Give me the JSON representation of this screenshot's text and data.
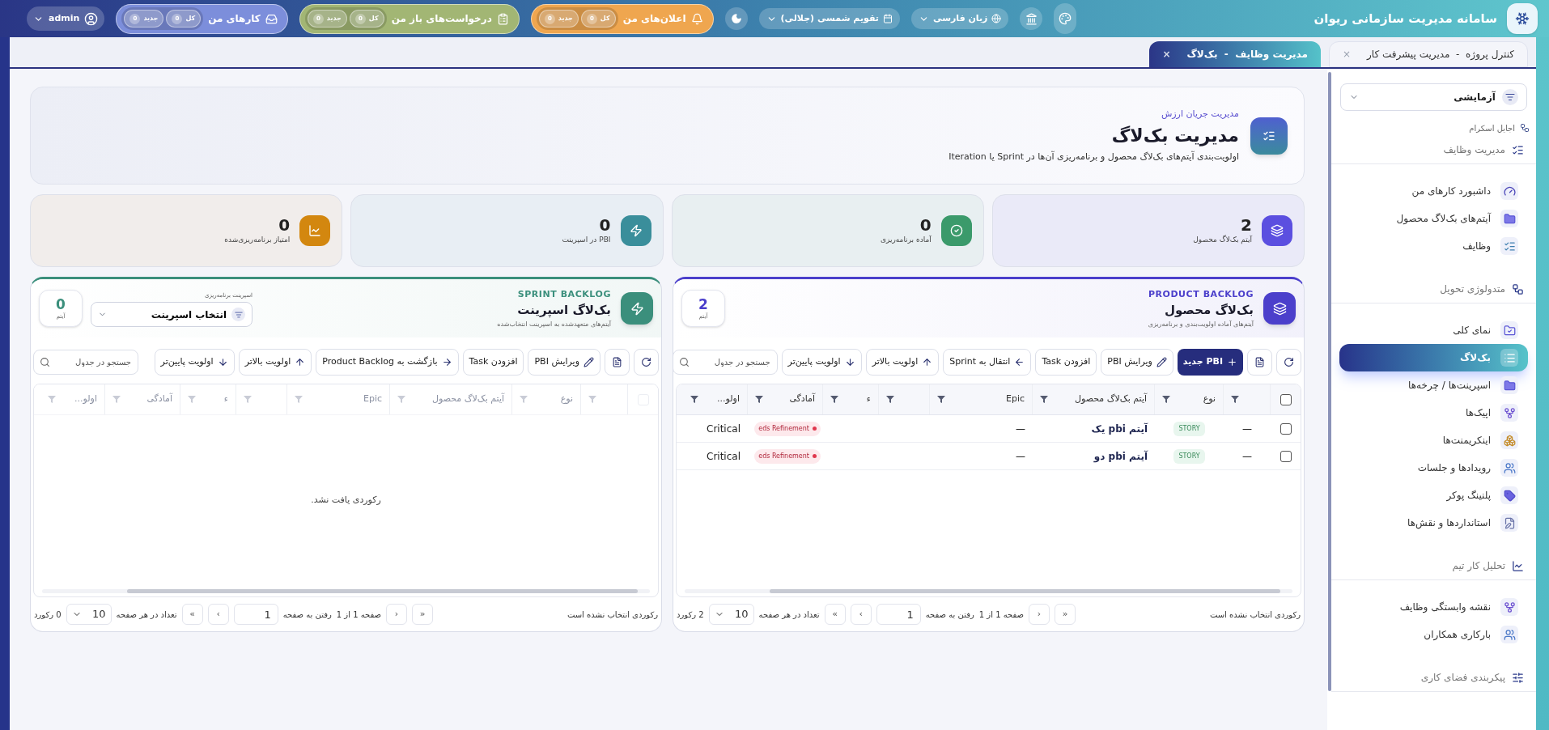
{
  "app": {
    "title": "سامانه مدیریت سازمانی ریوان"
  },
  "top_bar": {
    "language": "زبان فارسی",
    "calendar": "تقویم شمسی (جلالی)",
    "user": "admin",
    "pills": [
      {
        "label": "اعلان‌های من",
        "color": "#efa64f",
        "chips": [
          {
            "label": "کل",
            "count": "0"
          },
          {
            "label": "جدید",
            "count": "0"
          }
        ]
      },
      {
        "label": "درخواست‌های باز من",
        "color": "#a2b674",
        "chips": [
          {
            "label": "کل",
            "count": "0"
          },
          {
            "label": "جدید",
            "count": "0"
          }
        ]
      },
      {
        "label": "کارهای من",
        "color": "#7c8edb",
        "chips": [
          {
            "label": "کل",
            "count": "0"
          },
          {
            "label": "جدید",
            "count": "0"
          }
        ]
      }
    ]
  },
  "tabs": [
    {
      "label": "کنترل پروژه  -  مدیریت پیشرفت کار",
      "close": "×",
      "selected": false
    },
    {
      "label": "مدیریت وظایف  -  بک‌لاگ",
      "close": "×",
      "selected": true
    }
  ],
  "sidebar": {
    "workspace": "آزمایشی",
    "section": "اجایل اسکرام",
    "groups": [
      {
        "title": "مدیریت وظایف",
        "items": [
          {
            "label": "داشبورد کارهای من",
            "selected": false
          },
          {
            "label": "آیتم‌های بک‌لاگ محصول",
            "selected": false
          },
          {
            "label": "وظایف",
            "selected": false
          }
        ]
      },
      {
        "title": "متدولوژی تحویل",
        "items": [
          {
            "label": "نمای کلی",
            "selected": false
          },
          {
            "label": "بک‌لاگ",
            "selected": true
          },
          {
            "label": "اسپرینت‌ها / چرخه‌ها",
            "selected": false
          },
          {
            "label": "اپیک‌ها",
            "selected": false
          },
          {
            "label": "اینکریمنت‌ها",
            "selected": false
          },
          {
            "label": "رویدادها و جلسات",
            "selected": false
          },
          {
            "label": "پلنینگ پوکر",
            "selected": false
          },
          {
            "label": "استانداردها و نقش‌ها",
            "selected": false
          }
        ]
      },
      {
        "title": "تحلیل کار تیم",
        "items": [
          {
            "label": "نقشه وابستگی وظایف",
            "selected": false
          },
          {
            "label": "بارکاری همکاران",
            "selected": false
          }
        ]
      },
      {
        "title": "پیکربندی فضای کاری"
      }
    ]
  },
  "header": {
    "eyebrow": "مدیریت جریان ارزش",
    "title": "مدیریت بک‌لاگ",
    "description": "اولویت‌بندی آیتم‌های بک‌لاگ محصول و برنامه‌ریزی آن‌ها در Sprint یا Iteration"
  },
  "stats": [
    {
      "value": "2",
      "label": "آیتم بک‌لاگ محصول",
      "color": "#5b4fe0"
    },
    {
      "value": "0",
      "label": "آماده برنامه‌ریزی",
      "color": "#3b9a6b"
    },
    {
      "value": "0",
      "label": "PBI در اسپرینت",
      "color": "#3a8e9b"
    },
    {
      "value": "0",
      "label": "امتیاز برنامه‌ریزی‌شده",
      "color": "#d3870f"
    }
  ],
  "panels": [
    {
      "kind": "product",
      "color": "#4b3fcb",
      "eyebrow": "PRODUCT BACKLOG",
      "title": "بک‌لاگ محصول",
      "subtitle": "آیتم‌های آماده اولویت‌بندی و برنامه‌ریزی",
      "count": "2",
      "count_label": "آیتم",
      "toolbar": [
        {
          "kind": "refresh"
        },
        {
          "kind": "export"
        },
        {
          "kind": "create",
          "label": "PBI جدید"
        },
        {
          "kind": "edit",
          "label": "ویرایش PBI"
        },
        {
          "kind": "add",
          "label": "افزودن Task"
        },
        {
          "kind": "move",
          "label": "انتقال به Sprint"
        },
        {
          "kind": "raise",
          "label": "اولویت بالاتر"
        },
        {
          "kind": "lower",
          "label": "اولویت پایین‌تر"
        }
      ],
      "search": {
        "placeholder": "جستجو در جدول"
      },
      "table": {
        "faded": false,
        "columns": [
          {
            "kind": "checkbox",
            "checked": false
          },
          {
            "kind": "field"
          },
          {
            "kind": "field",
            "label": "نوع"
          },
          {
            "kind": "field",
            "label": "آیتم بک‌لاگ محصول"
          },
          {
            "kind": "field",
            "label": "Epic"
          },
          {
            "kind": "field"
          },
          {
            "kind": "field",
            "label": "ء"
          },
          {
            "kind": "field",
            "label": "آمادگی"
          },
          {
            "kind": "field",
            "label": "اولو..."
          }
        ],
        "rows": [
          {
            "checked": false,
            "col_2": "—",
            "type": "STORY",
            "title": "آیتم pbi یک",
            "epic": "—",
            "readiness": "eds Refinement",
            "priority": "Critical"
          },
          {
            "checked": false,
            "col_2": "—",
            "type": "STORY",
            "title": "آیتم pbi دو",
            "epic": "—",
            "readiness": "eds Refinement",
            "priority": "Critical"
          }
        ]
      },
      "pager": {
        "status": "رکوردی انتخاب نشده است",
        "first": "»",
        "prev": "›",
        "page_info": "صفحه 1 از 1",
        "goto_label": "رفتن به صفحه",
        "page": "1",
        "next": "‹",
        "last": "«",
        "per_page_label": "تعداد در هر صفحه",
        "per_page": "10",
        "total": "2 رکورد"
      }
    },
    {
      "kind": "sprint",
      "color": "#3b8f7c",
      "eyebrow": "SPRINT BACKLOG",
      "title": "بک‌لاگ اسپرینت",
      "subtitle": "آیتم‌های متعهدشده به اسپرینت انتخاب‌شده",
      "count": "0",
      "count_label": "آیتم",
      "select": {
        "label": "اسپرینت برنامه‌ریزی",
        "value": "انتخاب اسپرینت"
      },
      "toolbar": [
        {
          "kind": "refresh"
        },
        {
          "kind": "export"
        },
        {
          "kind": "edit",
          "label": "ویرایش PBI"
        },
        {
          "kind": "add",
          "label": "افزودن Task"
        },
        {
          "kind": "back",
          "label": "بازگشت به Product Backlog"
        },
        {
          "kind": "raise",
          "label": "اولویت بالاتر"
        },
        {
          "kind": "lower",
          "label": "اولویت پایین‌تر"
        }
      ],
      "search": {
        "placeholder": "جستجو در جدول"
      },
      "table": {
        "faded": true,
        "columns": [
          {
            "kind": "checkbox",
            "checked": false
          },
          {
            "kind": "field"
          },
          {
            "kind": "field",
            "label": "نوع"
          },
          {
            "kind": "field",
            "label": "آیتم بک‌لاگ محصول"
          },
          {
            "kind": "field",
            "label": "Epic"
          },
          {
            "kind": "field"
          },
          {
            "kind": "field",
            "label": "ء"
          },
          {
            "kind": "field",
            "label": "آمادگی"
          },
          {
            "kind": "field",
            "label": "اولو..."
          }
        ],
        "empty_message": "رکوردی یافت نشد."
      },
      "pager": {
        "status": "رکوردی انتخاب نشده است",
        "first": "»",
        "prev": "›",
        "page_info": "صفحه 1 از 1",
        "goto_label": "رفتن به صفحه",
        "page": "1",
        "next": "‹",
        "last": "«",
        "per_page_label": "تعداد در هر صفحه",
        "per_page": "10",
        "total": "0 رکورد"
      }
    }
  ]
}
